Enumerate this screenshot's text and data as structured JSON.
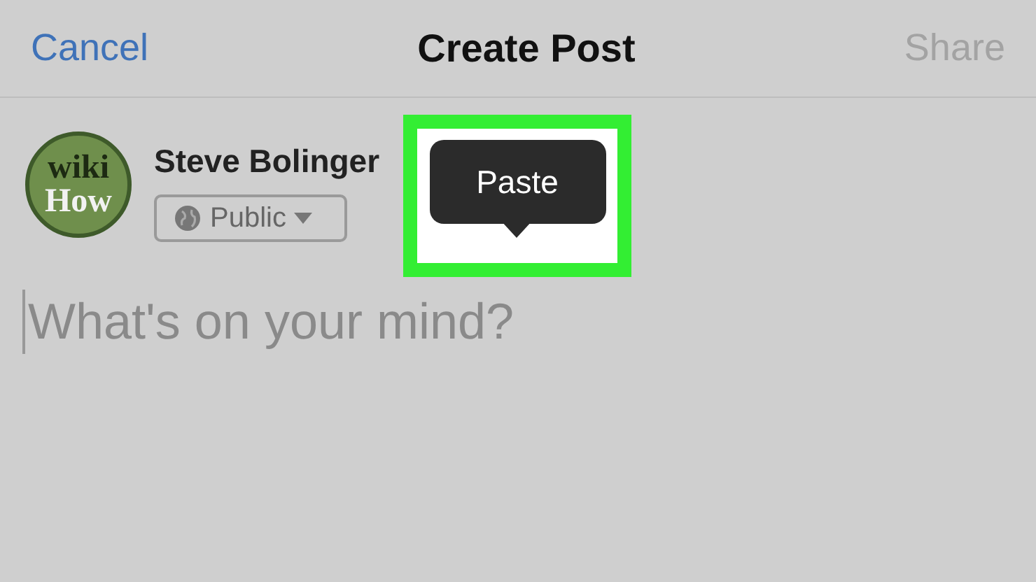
{
  "header": {
    "cancel": "Cancel",
    "title": "Create Post",
    "share": {
      "label": "Share",
      "disabled": true
    }
  },
  "composer": {
    "avatar_text": [
      "wiki",
      "How"
    ],
    "author": "Steve Bolinger",
    "audience": "Public",
    "placeholder": "What's on your mind?"
  },
  "tooltip": {
    "label": "Paste",
    "highlighted": true
  }
}
